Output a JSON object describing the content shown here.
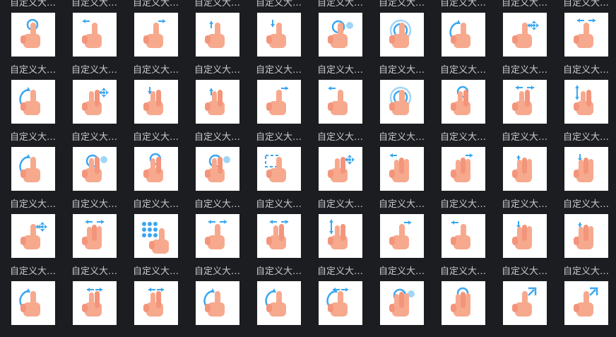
{
  "colors": {
    "background": "#1c1d21",
    "label": "#c7c9cf",
    "tile": "#ffffff",
    "skin": "#f7a98e",
    "skin_shade": "#f3957b",
    "accent": "#3ba7f0",
    "accent_light": "#9fd6f8"
  },
  "items": [
    {
      "label": "自定义大…",
      "icon": "tap-gesture-icon"
    },
    {
      "label": "自定义大…",
      "icon": "swipe-left-gesture-icon"
    },
    {
      "label": "自定义大…",
      "icon": "swipe-right-gesture-icon"
    },
    {
      "label": "自定义大…",
      "icon": "swipe-up-gesture-icon"
    },
    {
      "label": "自定义大…",
      "icon": "swipe-down-gesture-icon"
    },
    {
      "label": "自定义大…",
      "icon": "tap-hold-gesture-icon"
    },
    {
      "label": "自定义大…",
      "icon": "double-tap-gesture-icon"
    },
    {
      "label": "自定义大…",
      "icon": "rotate-gesture-icon"
    },
    {
      "label": "自定义大…",
      "icon": "drag-move-gesture-icon"
    },
    {
      "label": "自定义大…",
      "icon": "spread-horizontal-gesture-icon"
    },
    {
      "label": "自定义大…",
      "icon": "rotate-left-gesture-icon"
    },
    {
      "label": "自定义大…",
      "icon": "two-finger-move-gesture-icon"
    },
    {
      "label": "自定义大…",
      "icon": "two-finger-swipe-down-gesture-icon"
    },
    {
      "label": "自定义大…",
      "icon": "two-finger-swipe-up-gesture-icon"
    },
    {
      "label": "自定义大…",
      "icon": "flick-right-gesture-icon"
    },
    {
      "label": "自定义大…",
      "icon": "flick-left-gesture-icon"
    },
    {
      "label": "自定义大…",
      "icon": "double-tap-gesture-icon"
    },
    {
      "label": "自定义大…",
      "icon": "two-finger-tap-gesture-icon"
    },
    {
      "label": "自定义大…",
      "icon": "two-finger-swipe-horizontal-gesture-icon"
    },
    {
      "label": "自定义大…",
      "icon": "two-finger-swipe-vertical-gesture-icon"
    },
    {
      "label": "自定义大…",
      "icon": "rotate-right-gesture-icon"
    },
    {
      "label": "自定义大…",
      "icon": "two-finger-hold-gesture-icon"
    },
    {
      "label": "自定义大…",
      "icon": "two-finger-tap-gesture-icon"
    },
    {
      "label": "自定义大…",
      "icon": "two-finger-hold-gesture-icon"
    },
    {
      "label": "自定义大…",
      "icon": "select-area-gesture-icon"
    },
    {
      "label": "自定义大…",
      "icon": "two-finger-move-gesture-icon"
    },
    {
      "label": "自定义大…",
      "icon": "three-finger-swipe-left-gesture-icon"
    },
    {
      "label": "自定义大…",
      "icon": "three-finger-swipe-right-gesture-icon"
    },
    {
      "label": "自定义大…",
      "icon": "three-finger-swipe-up-gesture-icon"
    },
    {
      "label": "自定义大…",
      "icon": "three-finger-swipe-down-gesture-icon"
    },
    {
      "label": "自定义大…",
      "icon": "tap-move-gesture-icon"
    },
    {
      "label": "自定义大…",
      "icon": "three-finger-spread-gesture-icon"
    },
    {
      "label": "自定义大…",
      "icon": "dial-pad-gesture-icon"
    },
    {
      "label": "自定义大…",
      "icon": "spread-horizontal-gesture-icon"
    },
    {
      "label": "自定义大…",
      "icon": "two-finger-swipe-horizontal-gesture-icon"
    },
    {
      "label": "自定义大…",
      "icon": "two-finger-swipe-vertical-gesture-icon"
    },
    {
      "label": "自定义大…",
      "icon": "swipe-right-gesture-icon"
    },
    {
      "label": "自定义大…",
      "icon": "swipe-left-gesture-icon"
    },
    {
      "label": "自定义大…",
      "icon": "three-finger-swipe-down-gesture-icon"
    },
    {
      "label": "自定义大…",
      "icon": "three-finger-swipe-up-gesture-icon"
    },
    {
      "label": "自定义大…",
      "icon": "rotate-gesture-icon"
    },
    {
      "label": "自定义大…",
      "icon": "pinch-out-gesture-icon"
    },
    {
      "label": "自定义大…",
      "icon": "pinch-in-gesture-icon"
    },
    {
      "label": "自定义大…",
      "icon": "rotate-right-gesture-icon"
    },
    {
      "label": "自定义大…",
      "icon": "rotate-left-gesture-icon"
    },
    {
      "label": "自定义大…",
      "icon": "two-hand-rotate-gesture-icon"
    },
    {
      "label": "自定义大…",
      "icon": "three-finger-hold-gesture-icon"
    },
    {
      "label": "自定义大…",
      "icon": "three-finger-tap-gesture-icon"
    },
    {
      "label": "自定义大…",
      "icon": "zoom-out-gesture-icon"
    },
    {
      "label": "自定义大…",
      "icon": "zoom-in-gesture-icon"
    }
  ]
}
